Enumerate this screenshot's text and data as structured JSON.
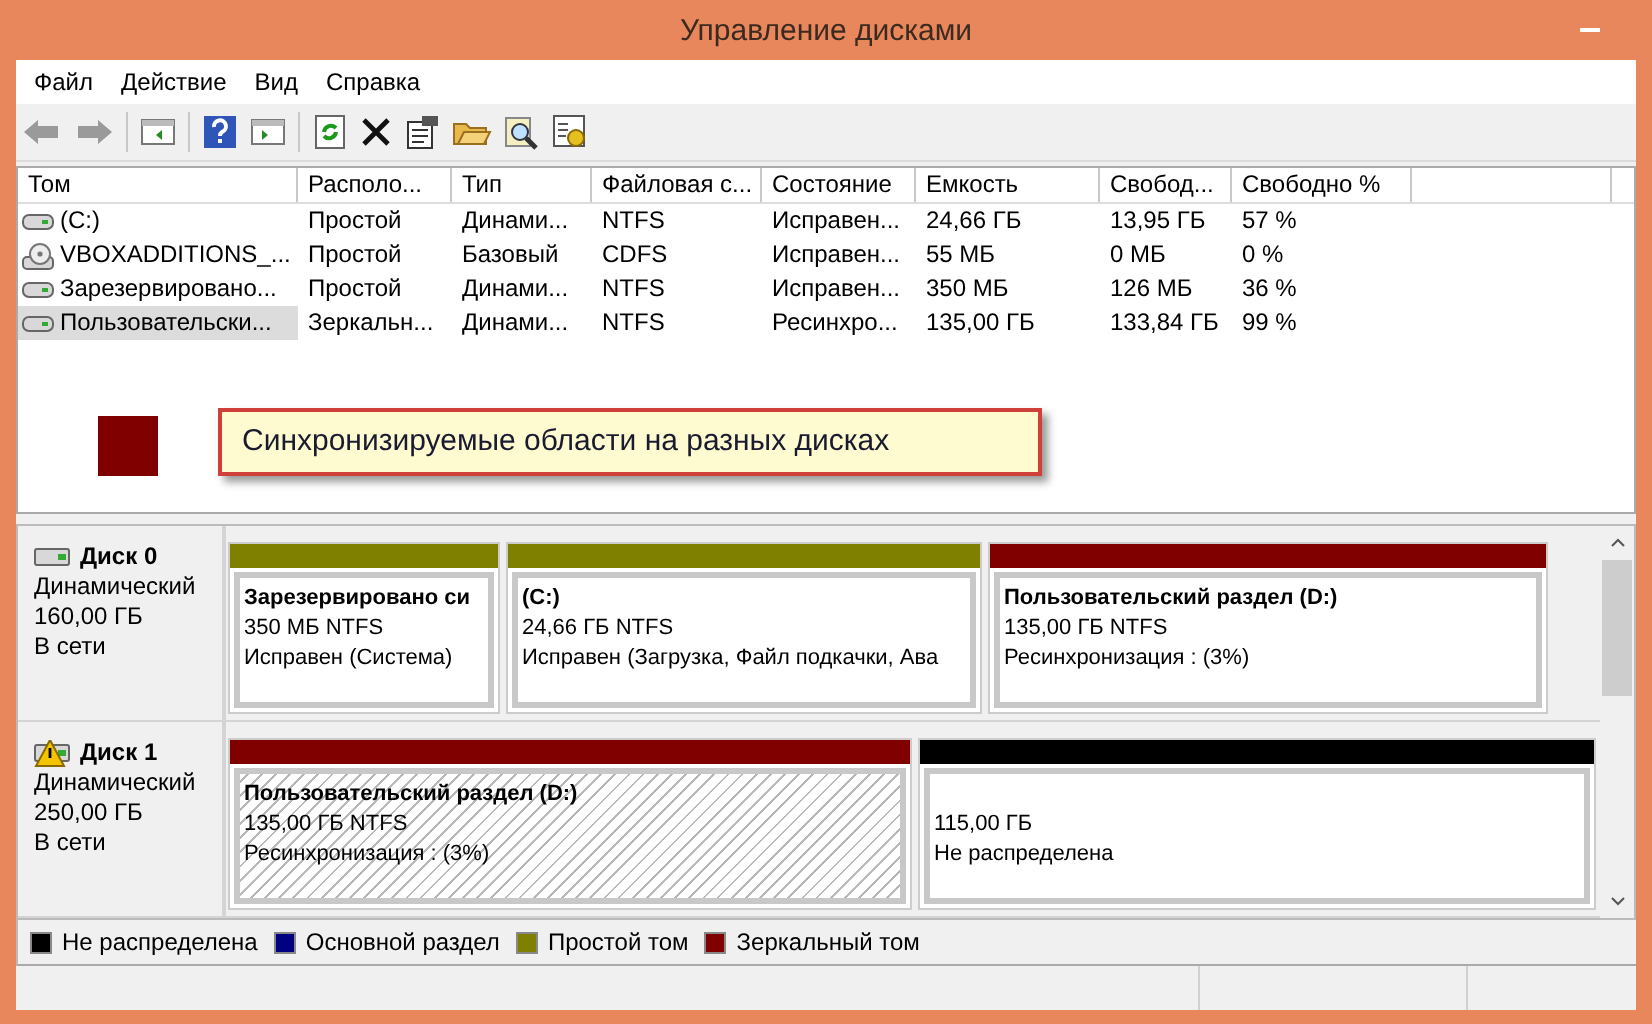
{
  "window": {
    "title": "Управление дисками"
  },
  "menu": [
    "Файл",
    "Действие",
    "Вид",
    "Справка"
  ],
  "volumes": {
    "columns": [
      "Том",
      "Располо...",
      "Тип",
      "Файловая с...",
      "Состояние",
      "Емкость",
      "Свобод...",
      "Свободно %"
    ],
    "rows": [
      {
        "kind": "hdd",
        "selected": false,
        "cells": [
          "(C:)",
          "Простой",
          "Динами...",
          "NTFS",
          "Исправен...",
          "24,66 ГБ",
          "13,95 ГБ",
          "57 %"
        ]
      },
      {
        "kind": "cd",
        "selected": false,
        "cells": [
          "VBOXADDITIONS_...",
          "Простой",
          "Базовый",
          "CDFS",
          "Исправен...",
          "55 МБ",
          "0 МБ",
          "0 %"
        ]
      },
      {
        "kind": "hdd",
        "selected": false,
        "cells": [
          "Зарезервировано...",
          "Простой",
          "Динами...",
          "NTFS",
          "Исправен...",
          "350 МБ",
          "126 МБ",
          "36 %"
        ]
      },
      {
        "kind": "hdd",
        "selected": true,
        "cells": [
          "Пользовательски...",
          "Зеркальн...",
          "Динами...",
          "NTFS",
          "Ресинхро...",
          "135,00 ГБ",
          "133,84 ГБ",
          "99 %"
        ]
      }
    ]
  },
  "callout": {
    "text": "Синхронизируемые области на разных дисках",
    "color": "#800000"
  },
  "disks": [
    {
      "name": "Диск 0",
      "warning": false,
      "type": "Динамический",
      "size": "160,00 ГБ",
      "status": "В сети",
      "partitions": [
        {
          "color": "#808000",
          "selected": false,
          "title": "Зарезервировано си",
          "size": "350 МБ NTFS",
          "status": "Исправен (Система)"
        },
        {
          "color": "#808000",
          "selected": false,
          "title": " (C:)",
          "size": "24,66 ГБ NTFS",
          "status": "Исправен (Загрузка, Файл подкачки, Ава"
        },
        {
          "color": "#800000",
          "selected": false,
          "title": "Пользовательский раздел  (D:)",
          "size": "135,00 ГБ NTFS",
          "status": "Ресинхронизация : (3%)"
        }
      ]
    },
    {
      "name": "Диск 1",
      "warning": true,
      "type": "Динамический",
      "size": "250,00 ГБ",
      "status": "В сети",
      "partitions": [
        {
          "color": "#800000",
          "selected": true,
          "title": "Пользовательский раздел  (D:)",
          "size": "135,00 ГБ NTFS",
          "status": "Ресинхронизация : (3%)"
        },
        {
          "color": "#000000",
          "selected": false,
          "size": "115,00 ГБ",
          "status": "Не распределена"
        }
      ]
    }
  ],
  "legend": [
    {
      "label": "Не распределена",
      "color": "#000000"
    },
    {
      "label": "Основной раздел",
      "color": "#000080"
    },
    {
      "label": "Простой том",
      "color": "#808000"
    },
    {
      "label": "Зеркальный том",
      "color": "#800000"
    }
  ]
}
